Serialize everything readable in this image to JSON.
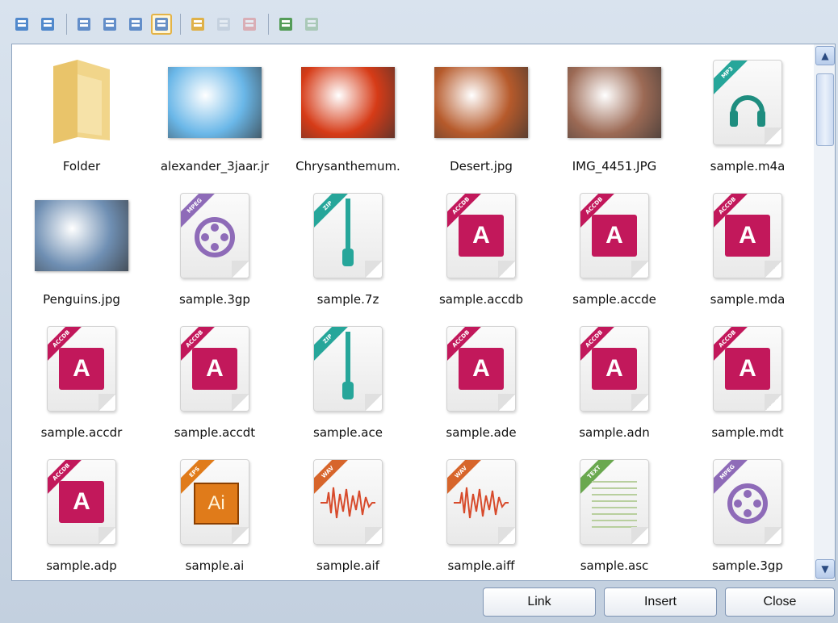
{
  "toolbar": {
    "buttons": [
      "thumbnails-icon",
      "refresh-icon",
      "view-details-icon",
      "view-list-icon",
      "view-tiles-icon",
      "view-large-icons-icon",
      "new-folder-icon",
      "rename-icon",
      "delete-icon",
      "upload-icon",
      "download-icon"
    ]
  },
  "files": [
    {
      "label": "Folder",
      "kind": "folder"
    },
    {
      "label": "alexander_3jaar.jr",
      "kind": "photo",
      "color": "#6ab7e8"
    },
    {
      "label": "Chrysanthemum.",
      "kind": "photo",
      "color": "#d63b17"
    },
    {
      "label": "Desert.jpg",
      "kind": "photo",
      "color": "#b65a2b"
    },
    {
      "label": "IMG_4451.JPG",
      "kind": "photo",
      "color": "#9c6a55"
    },
    {
      "label": "sample.m4a",
      "kind": "audio",
      "tag": "MP3"
    },
    {
      "label": "Penguins.jpg",
      "kind": "photo",
      "color": "#6f8fb3"
    },
    {
      "label": "sample.3gp",
      "kind": "video",
      "tag": "MPEG"
    },
    {
      "label": "sample.7z",
      "kind": "zip",
      "tag": "ZIP"
    },
    {
      "label": "sample.accdb",
      "kind": "access",
      "tag": "ACCDB"
    },
    {
      "label": "sample.accde",
      "kind": "access",
      "tag": "ACCDB"
    },
    {
      "label": "sample.mda",
      "kind": "access",
      "tag": "ACCDB"
    },
    {
      "label": "sample.accdr",
      "kind": "access",
      "tag": "ACCDB"
    },
    {
      "label": "sample.accdt",
      "kind": "access",
      "tag": "ACCDB"
    },
    {
      "label": "sample.ace",
      "kind": "zip",
      "tag": "ZIP"
    },
    {
      "label": "sample.ade",
      "kind": "access",
      "tag": "ACCDB"
    },
    {
      "label": "sample.adn",
      "kind": "access",
      "tag": "ACCDB"
    },
    {
      "label": "sample.mdt",
      "kind": "access",
      "tag": "ACCDB"
    },
    {
      "label": "sample.adp",
      "kind": "access",
      "tag": "ACCDB"
    },
    {
      "label": "sample.ai",
      "kind": "ai",
      "tag": "EPS"
    },
    {
      "label": "sample.aif",
      "kind": "wave",
      "tag": "WAV"
    },
    {
      "label": "sample.aiff",
      "kind": "wave",
      "tag": "WAV"
    },
    {
      "label": "sample.asc",
      "kind": "text",
      "tag": "TEXT"
    },
    {
      "label": "sample.3gp",
      "kind": "video",
      "tag": "MPEG"
    }
  ],
  "buttons": {
    "link": "Link",
    "insert": "Insert",
    "close": "Close"
  }
}
